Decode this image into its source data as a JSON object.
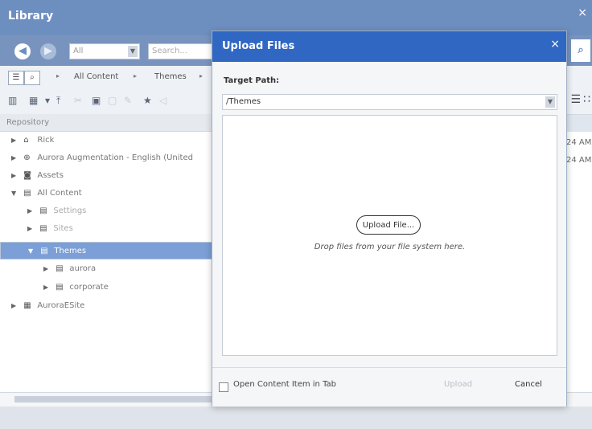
{
  "window": {
    "title": "Library",
    "close": "×"
  },
  "nav": {
    "back": "◀",
    "forward": "▶",
    "filter_value": "All",
    "search_placeholder": "Search...",
    "search_icon": "search-icon"
  },
  "breadcrumb": {
    "items": [
      "All Content",
      "Themes"
    ],
    "separator": "▸",
    "view_button": "tree-icon",
    "search_button": "search-icon"
  },
  "repository": {
    "label": "Repository"
  },
  "tree": {
    "nodes": [
      {
        "label": "Rick",
        "expander": "▶",
        "icon": "⌂"
      },
      {
        "label": "Aurora Augmentation - English (United",
        "expander": "▶",
        "icon": "⊕"
      },
      {
        "label": "Assets",
        "expander": "▶",
        "icon": "◙"
      },
      {
        "label": "All Content",
        "expander": "▼",
        "icon": "▤"
      },
      {
        "label": "Settings",
        "expander": "▶",
        "icon": "▤"
      },
      {
        "label": "Sites",
        "expander": "▶",
        "icon": "▤"
      },
      {
        "label": "Themes",
        "expander": "▼",
        "icon": "▤"
      },
      {
        "label": "aurora",
        "expander": "▶",
        "icon": "▤"
      },
      {
        "label": "corporate",
        "expander": "▶",
        "icon": "▤"
      },
      {
        "label": "AuroraESite",
        "expander": "▶",
        "icon": "▦"
      }
    ]
  },
  "right_times": [
    "24 AM",
    "24 AM"
  ],
  "dialog": {
    "title": "Upload Files",
    "close": "×",
    "target_path_label": "Target Path:",
    "target_path_value": "/Themes",
    "upload_file_button": "Upload File...",
    "drop_hint": "Drop files from your file system here.",
    "open_in_tab_label": "Open Content Item in Tab",
    "upload_button": "Upload",
    "cancel_button": "Cancel"
  }
}
